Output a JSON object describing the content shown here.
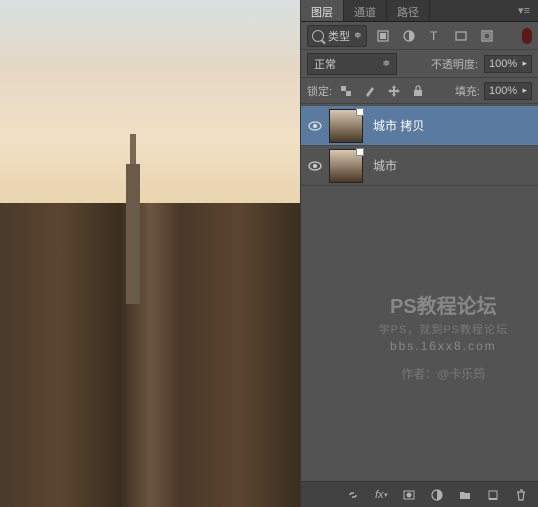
{
  "tabs": {
    "layers": "图层",
    "channels": "通道",
    "paths": "路径"
  },
  "filter": {
    "label": "类型",
    "chevron": "≑"
  },
  "blend": {
    "mode": "正常",
    "opacity_label": "不透明度:",
    "opacity_value": "100%"
  },
  "lock": {
    "label": "锁定:",
    "fill_label": "填充:",
    "fill_value": "100%"
  },
  "layers": [
    {
      "name": "城市 拷贝",
      "visible": true,
      "selected": true
    },
    {
      "name": "城市",
      "visible": true,
      "selected": false
    }
  ],
  "watermark": {
    "line1": "PS教程论坛",
    "line2": "学PS，就到PS教程论坛",
    "line3": "bbs.16xx8.com",
    "line4": "作者：@卡乐筠"
  },
  "bottom_icons": [
    "link",
    "fx",
    "mask",
    "adjust",
    "group",
    "new",
    "trash"
  ]
}
